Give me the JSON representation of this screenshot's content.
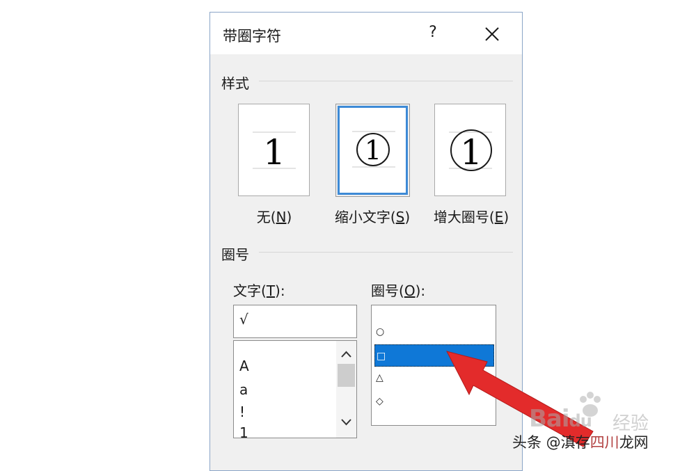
{
  "dialog": {
    "title": "带圈字符",
    "help_label": "?",
    "style_group": {
      "label": "样式",
      "options": [
        {
          "preview": "1",
          "label_prefix": "无(",
          "hotkey": "N",
          "label_suffix": ")"
        },
        {
          "preview": "①",
          "label_prefix": "缩小文字(",
          "hotkey": "S",
          "label_suffix": ")",
          "selected": true
        },
        {
          "preview": "1",
          "label_prefix": "增大圈号(",
          "hotkey": "E",
          "label_suffix": ")"
        }
      ]
    },
    "enclosure_group": {
      "label": "圈号",
      "text_field": {
        "label_prefix": "文字(",
        "hotkey": "T",
        "label_suffix": "):",
        "value": "√",
        "list_items": [
          "A",
          "a",
          "!",
          "1"
        ]
      },
      "enclosure_field": {
        "label_prefix": "圈号(",
        "hotkey": "O",
        "label_suffix": "):",
        "items": [
          "○",
          "□",
          "△",
          "◇"
        ],
        "selected_index": 1
      }
    }
  },
  "overlay": {
    "watermark_baidu": "Bai",
    "watermark_du": "du",
    "watermark_jingyan": "经验",
    "source_tag_prefix": "头条 @滇存",
    "source_tag_highlight": "四川",
    "source_tag_suffix": "龙网"
  },
  "colors": {
    "selection_blue": "#0f78d7",
    "selected_border": "#3d8ad6",
    "arrow_red": "#e32b2b"
  }
}
